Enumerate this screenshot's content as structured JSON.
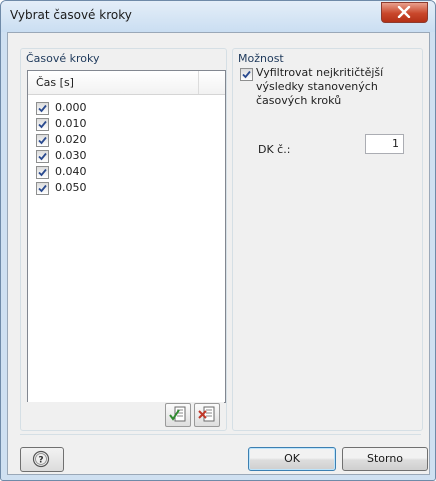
{
  "window": {
    "title": "Vybrat časové kroky"
  },
  "left_group": {
    "title": "Časové kroky",
    "column_header": "Čas [s]",
    "rows": [
      {
        "label": "0.000",
        "checked": true
      },
      {
        "label": "0.010",
        "checked": true
      },
      {
        "label": "0.020",
        "checked": true
      },
      {
        "label": "0.030",
        "checked": true
      },
      {
        "label": "0.040",
        "checked": true
      },
      {
        "label": "0.050",
        "checked": true
      }
    ],
    "toolbar": {
      "select_all_icon": "check-all-icon",
      "deselect_all_icon": "uncheck-all-icon"
    }
  },
  "right_group": {
    "title": "Možnost",
    "filter_checked": true,
    "filter_label": "Vyfiltrovat nejkritičtější výsledky stanovených časových kroků",
    "dk_label": "DK č.:",
    "dk_value": "1"
  },
  "footer": {
    "help_icon": "help-icon",
    "ok_label": "OK",
    "cancel_label": "Storno"
  },
  "colors": {
    "group_title": "#1e395b",
    "close_button": "#c9472b",
    "dialog_bg": "#f0f0f0"
  }
}
